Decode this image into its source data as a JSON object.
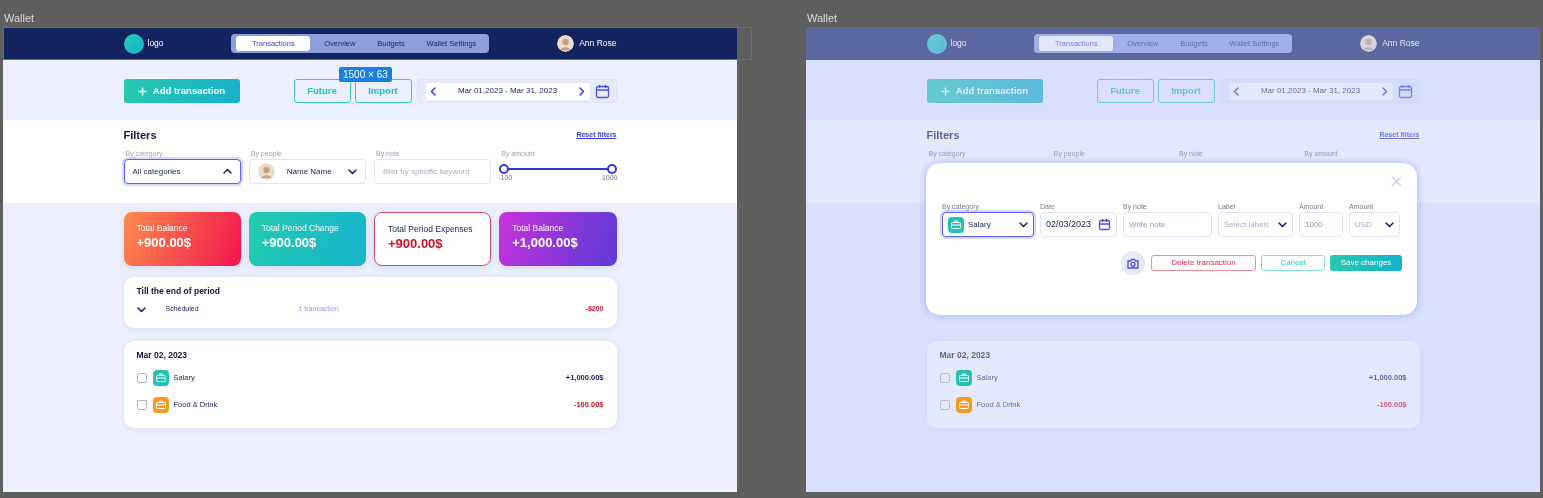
{
  "canvas_frames": [
    {
      "title": "Wallet",
      "dimmed": false,
      "selection_size": "1500 × 63",
      "navbar": {
        "logo": "logo",
        "tabs": [
          {
            "label": "Transactions",
            "selected": true
          },
          {
            "label": "Overview",
            "selected": false
          },
          {
            "label": "Budgets",
            "selected": false
          },
          {
            "label": "Wallet Settings",
            "selected": false
          }
        ],
        "user": "Ann Rose"
      },
      "toolbar": {
        "add_button": "Add transaction",
        "buttons": [
          "Future",
          "Import"
        ],
        "date_range": "Mar 01,2023 - Mar 31, 2023"
      },
      "filters": {
        "title": "Filters",
        "reset": "Reset filters",
        "fields": [
          {
            "label": "By category",
            "kind": "select",
            "value": "All categories",
            "focused": true,
            "expanded": true
          },
          {
            "label": "By people",
            "kind": "person",
            "value": "Name Name",
            "focused": false,
            "expanded": false
          },
          {
            "label": "By note",
            "kind": "text",
            "placeholder": "filter by specific keyword",
            "focused": false
          },
          {
            "label": "By amount",
            "kind": "range",
            "min": "-100",
            "max": "1000"
          }
        ]
      },
      "summary_cards": [
        {
          "title": "Total Balance",
          "amount": "+900.00$",
          "kind": "sunset"
        },
        {
          "title": "Total Period Change",
          "amount": "+900.00$",
          "kind": "ocean"
        },
        {
          "title": "Total Period Expenses",
          "amount": "+900.00$",
          "kind": "outline"
        },
        {
          "title": "Total Balance",
          "amount": "+1,000.00$",
          "kind": "violet"
        }
      ],
      "period_card": {
        "title": "Till the end of period",
        "rows": [
          {
            "label": "Scheduled",
            "count": "1 transaction",
            "amount": "-$200",
            "expanded": false,
            "kind": "expense"
          }
        ]
      },
      "day_groups": [
        {
          "date": "Mar 02, 2023",
          "transactions": [
            {
              "name": "Salary",
              "amount": "+1,000.00$",
              "kind": "income",
              "checked": false,
              "color": "#22c4b4"
            },
            {
              "name": "Food & Drink",
              "amount": "-100.00$",
              "kind": "expense",
              "checked": false,
              "color": "#f89a1c"
            }
          ]
        }
      ]
    },
    {
      "title": "Wallet",
      "dimmed": true,
      "navbar": {
        "logo": "logo",
        "tabs": [
          {
            "label": "Transactions",
            "selected": true
          },
          {
            "label": "Overview",
            "selected": false
          },
          {
            "label": "Budgets",
            "selected": false
          },
          {
            "label": "Wallet Settings",
            "selected": false
          }
        ],
        "user": "Ann Rose"
      },
      "toolbar": {
        "add_button": "Add transaction",
        "buttons": [
          "Future",
          "Import"
        ],
        "date_range": "Mar 01,2023 - Mar 31, 2023"
      },
      "filters": {
        "title": "Filters",
        "reset": "Reset filters",
        "fields": [
          {
            "label": "By category"
          },
          {
            "label": "By people"
          },
          {
            "label": "By note"
          },
          {
            "label": "By amount"
          }
        ]
      },
      "modal": {
        "fields": [
          {
            "label": "By category",
            "kind": "category",
            "value": "Salary",
            "color": "#22c4b4",
            "focused": true
          },
          {
            "label": "Date",
            "kind": "date",
            "value": "02/03/2023",
            "focused": false
          },
          {
            "label": "By note",
            "kind": "text",
            "placeholder": "Write note",
            "focused": false
          },
          {
            "label": "Label",
            "kind": "select",
            "placeholder": "Select labels",
            "focused": false
          },
          {
            "label": "Amount",
            "kind": "text",
            "placeholder": "1000",
            "focused": false
          },
          {
            "label": "Amount",
            "kind": "select",
            "placeholder": "USD",
            "focused": false
          }
        ],
        "actions": [
          {
            "label": "Delete transaction",
            "kind": "danger"
          },
          {
            "label": "Cancel",
            "kind": "outline"
          },
          {
            "label": "Save changes",
            "kind": "primary"
          }
        ]
      },
      "day_groups": [
        {
          "date": "Mar 02, 2023",
          "transactions": [
            {
              "name": "Salary",
              "amount": "+1,000.00$",
              "kind": "income",
              "checked": false,
              "color": "#22c4b4"
            },
            {
              "name": "Food & Drink",
              "amount": "-100.00$",
              "kind": "expense",
              "checked": false,
              "color": "#f89a1c"
            }
          ]
        }
      ]
    }
  ]
}
